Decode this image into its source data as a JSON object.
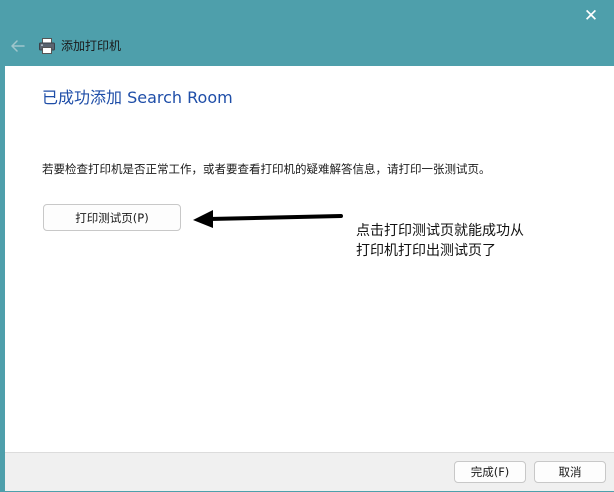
{
  "titlebar": {
    "close_glyph": "✕",
    "wizard_title": "添加打印机"
  },
  "content": {
    "heading": "已成功添加 Search Room",
    "description": "若要检查打印机是否正常工作，或者要查看打印机的疑难解答信息，请打印一张测试页。",
    "test_page_button": "打印测试页(P)"
  },
  "annotation": {
    "line1": "点击打印测试页就能成功从",
    "line2": "打印机打印出测试页了"
  },
  "footer": {
    "finish_label": "完成(F)",
    "cancel_label": "取消"
  },
  "colors": {
    "titlebar": "#4e9fab",
    "heading": "#1f4ea8",
    "content_bg": "#ffffff",
    "footer_bg": "#f0f0f0"
  },
  "icons": {
    "close": "close-icon",
    "back": "back-arrow-icon",
    "printer": "printer-icon",
    "annotation": "arrow-left-icon"
  }
}
